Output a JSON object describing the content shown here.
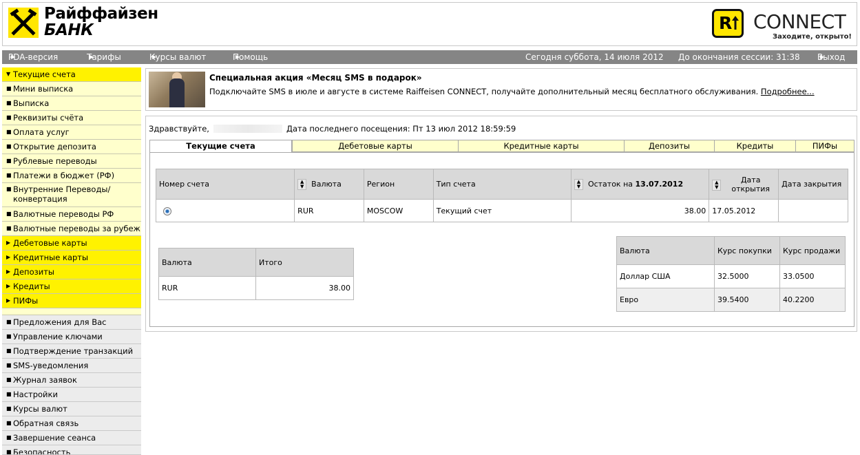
{
  "header": {
    "bank_name_line1": "Райффайзен",
    "bank_name_line2": "БАНК",
    "connect_letter": "R",
    "connect_word": "CONNECT",
    "connect_slogan": "Заходите, открыто!",
    "brand_yellow": "#ffe600"
  },
  "topnav": {
    "pda": "PDA-версия",
    "tariffs": "Тарифы",
    "rates": "Курсы валют",
    "help": "Помощь",
    "today": "Сегодня суббота, 14 июля 2012",
    "session": "До окончания сессии: 31:38",
    "logout": "Выход"
  },
  "sidebar": {
    "current_accounts": "Текущие счета",
    "sub": [
      "Мини выписка",
      "Выписка",
      "Реквизиты счёта",
      "Оплата услуг",
      "Открытие депозита",
      "Рублевые переводы",
      "Платежи в бюджет (РФ)",
      "Внутренние Переводы/ конвертация",
      "Валютные переводы РФ",
      "Валютные переводы за рубеж"
    ],
    "sections": [
      "Дебетовые карты",
      "Кредитные карты",
      "Депозиты",
      "Кредиты",
      "ПИФы"
    ],
    "service": [
      "Предложения для Вас",
      "Управление ключами",
      "Подтверждение транзакций",
      "SMS-уведомления",
      "Журнал заявок",
      "Настройки",
      "Курсы валют",
      "Обратная связь",
      "Завершение сеанса",
      "Безопасность"
    ]
  },
  "promo": {
    "title": "Специальная акция «Месяц SMS в подарок»",
    "text": "Подключайте SMS в июле и августе в системе Raiffeisen CONNECT, получайте дополнительный месяц бесплатного обслуживания.",
    "link": "Подробнее..."
  },
  "greeting": {
    "hello": "Здравствуйте,",
    "last_visit": "Дата последнего посещения: Пт 13 июл 2012 18:59:59"
  },
  "tabs": [
    "Текущие счета",
    "Дебетовые карты",
    "Кредитные карты",
    "Депозиты",
    "Кредиты",
    "ПИФы"
  ],
  "accounts_table": {
    "headers": {
      "number": "Номер счета",
      "currency": "Валюта",
      "region": "Регион",
      "type": "Тип счета",
      "balance_prefix": "Остаток на",
      "balance_date": "13.07.2012",
      "opened": "Дата открытия",
      "closed": "Дата закрытия"
    },
    "row": {
      "currency": "RUR",
      "region": "MOSCOW",
      "type": "Текущий счет",
      "balance": "38.00",
      "opened": "17.05.2012",
      "closed": ""
    }
  },
  "totals_table": {
    "headers": [
      "Валюта",
      "Итого"
    ],
    "rows": [
      [
        "RUR",
        "38.00"
      ]
    ]
  },
  "rates_table": {
    "headers": [
      "Валюта",
      "Курс покупки",
      "Курс продажи"
    ],
    "rows": [
      [
        "Доллар США",
        "32.5000",
        "33.0500"
      ],
      [
        "Евро",
        "39.5400",
        "40.2200"
      ]
    ]
  }
}
